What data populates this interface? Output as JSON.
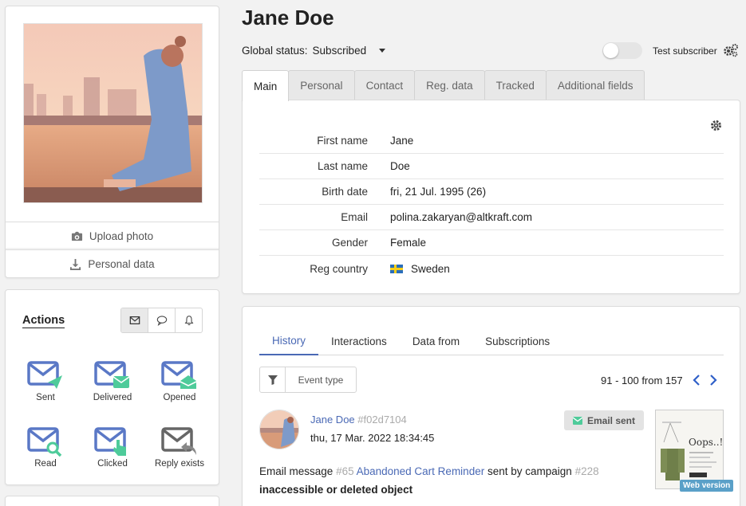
{
  "profile": {
    "name": "Jane Doe",
    "upload_photo": "Upload photo",
    "personal_data": "Personal data"
  },
  "actions": {
    "title": "Actions",
    "channels": [
      "email-icon",
      "chat-icon",
      "bell-icon"
    ],
    "items": [
      {
        "label": "Sent",
        "icon": "email-sent-icon"
      },
      {
        "label": "Delivered",
        "icon": "email-delivered-icon"
      },
      {
        "label": "Opened",
        "icon": "email-opened-icon"
      },
      {
        "label": "Read",
        "icon": "email-read-icon"
      },
      {
        "label": "Clicked",
        "icon": "email-clicked-icon"
      },
      {
        "label": "Reply exists",
        "icon": "email-reply-icon"
      }
    ]
  },
  "header": {
    "global_status_label": "Global status:",
    "global_status_value": "Subscribed",
    "test_subscriber": "Test subscriber"
  },
  "tabs": [
    "Main",
    "Personal",
    "Contact",
    "Reg. data",
    "Tracked",
    "Additional fields"
  ],
  "fields": [
    {
      "label": "First name",
      "value": "Jane"
    },
    {
      "label": "Last name",
      "value": "Doe"
    },
    {
      "label": "Birth date",
      "value": "fri, 21 Jul. 1995 (26)"
    },
    {
      "label": "Email",
      "value": "polina.zakaryan@altkraft.com"
    },
    {
      "label": "Gender",
      "value": "Female"
    },
    {
      "label": "Reg country",
      "value": "Sweden"
    }
  ],
  "history": {
    "tabs": [
      "History",
      "Interactions",
      "Data from",
      "Subscriptions"
    ],
    "filter_label": "Event type",
    "pager": "91 - 100 from 157",
    "event": {
      "user_name": "Jane Doe",
      "user_hash": "#f02d7104",
      "time": "thu, 17 Mar. 2022 18:34:45",
      "badge": "Email sent",
      "desc_prefix": "Email message",
      "message_id": "#65",
      "message_name": "Abandoned Cart Reminder",
      "desc_mid": "sent by campaign",
      "campaign_id": "#228",
      "desc_bold": "inaccessible or deleted object",
      "thumb_text": "Oops..!",
      "web_version": "Web version"
    }
  },
  "colors": {
    "accent": "#4a69b5",
    "icon_blue": "#5a78c6",
    "icon_green": "#4ecb9a"
  }
}
